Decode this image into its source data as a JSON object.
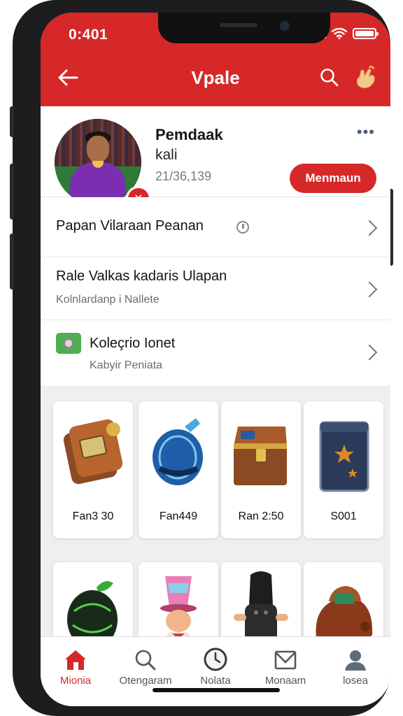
{
  "status_bar": {
    "time": "0:401"
  },
  "header": {
    "title": "Vpale"
  },
  "profile": {
    "name": "Pemdaak",
    "subtitle": "kali",
    "count": "21/36,139",
    "action_label": "Menmaun"
  },
  "menu": {
    "items": [
      {
        "title": "Papan Vilaraan Peanan",
        "subtitle": ""
      },
      {
        "title": "Rale Valkas kadaris Ulapan",
        "subtitle": "Kolnlardanp i Nallete"
      },
      {
        "title": "Koleçrio Ionet",
        "subtitle": "Kabyir Peniata"
      }
    ]
  },
  "items_grid": [
    {
      "label": "Fan3 30",
      "icon": "leather-wallet-icon"
    },
    {
      "label": "Fan449",
      "icon": "blue-helmet-icon"
    },
    {
      "label": "Ran 2:50",
      "icon": "treasure-chest-icon"
    },
    {
      "label": "S001",
      "icon": "star-chest-icon"
    },
    {
      "label": "",
      "icon": "green-egg-icon"
    },
    {
      "label": "",
      "icon": "hat-character-icon"
    },
    {
      "label": "",
      "icon": "hooded-figure-icon"
    },
    {
      "label": "",
      "icon": "leather-bag-icon"
    }
  ],
  "bottom_nav": {
    "items": [
      {
        "label": "Mionia",
        "icon": "home-icon",
        "active": true
      },
      {
        "label": "Otengaram",
        "icon": "search-icon",
        "active": false
      },
      {
        "label": "Nolata",
        "icon": "clock-icon",
        "active": false
      },
      {
        "label": "Monaam",
        "icon": "mail-icon",
        "active": false
      },
      {
        "label": "losea",
        "icon": "person-icon",
        "active": false
      }
    ]
  },
  "colors": {
    "primary": "#d62828",
    "background": "#efefef",
    "card": "#ffffff",
    "text": "#141414"
  }
}
